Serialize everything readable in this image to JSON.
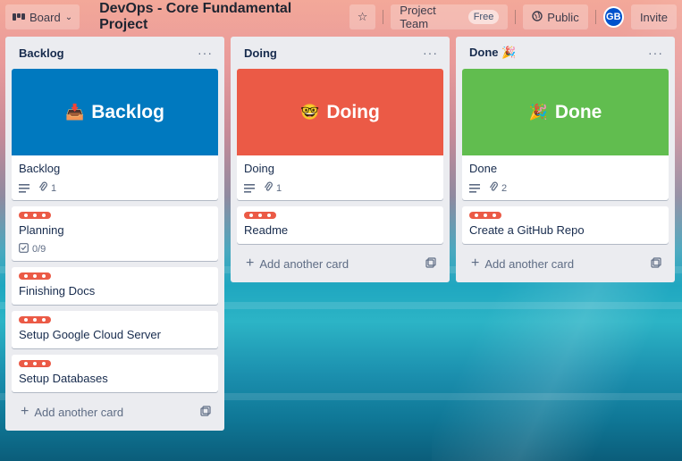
{
  "header": {
    "board_switcher": "Board",
    "title": "DevOps - Core Fundamental Project",
    "workspace": "Project Team",
    "workspace_badge": "Free",
    "visibility": "Public",
    "avatar_initials": "GB",
    "invite": "Invite"
  },
  "lists": [
    {
      "title": "Backlog",
      "menu": "···",
      "cover_card": {
        "cover_color": "#0079bf",
        "cover_emoji": "📥",
        "cover_text": "Backlog",
        "title": "Backlog",
        "attachments": "1"
      },
      "cards": [
        {
          "title": "Planning",
          "checklist": "0/9"
        },
        {
          "title": "Finishing Docs"
        },
        {
          "title": "Setup Google Cloud Server"
        },
        {
          "title": "Setup Databases"
        }
      ],
      "add_card": "Add another card"
    },
    {
      "title": "Doing",
      "menu": "···",
      "cover_card": {
        "cover_color": "#eb5a46",
        "cover_emoji": "🤓",
        "cover_text": "Doing",
        "title": "Doing",
        "attachments": "1"
      },
      "cards": [
        {
          "title": "Readme"
        }
      ],
      "add_card": "Add another card"
    },
    {
      "title": "Done 🎉",
      "menu": "···",
      "cover_card": {
        "cover_color": "#61bd4f",
        "cover_emoji": "🎉",
        "cover_text": "Done",
        "title": "Done",
        "attachments": "2"
      },
      "cards": [
        {
          "title": "Create a GitHub Repo"
        }
      ],
      "add_card": "Add another card"
    }
  ],
  "colors": {
    "label_red": "#eb5a46",
    "list_bg": "#ebecf0"
  }
}
